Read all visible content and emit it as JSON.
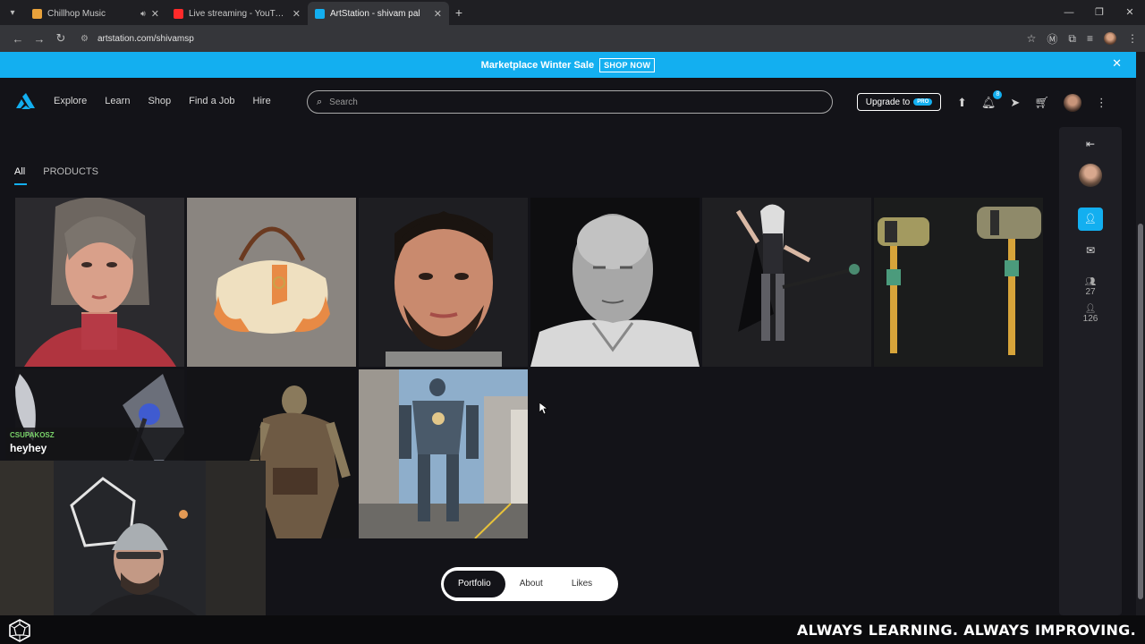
{
  "browser": {
    "tabs": [
      {
        "title": "Chillhop Music",
        "fav_color": "#e9a23b",
        "audio": true
      },
      {
        "title": "Live streaming - YouTube Studio",
        "fav_color": "#ff2a2a",
        "audio": false
      },
      {
        "title": "ArtStation - shivam pal",
        "fav_color": "#13aff0",
        "audio": false
      }
    ],
    "url": "artstation.com/shivamsp"
  },
  "promo": {
    "text": "Marketplace Winter Sale",
    "cta": "SHOP NOW"
  },
  "header": {
    "nav": [
      "Explore",
      "Learn",
      "Shop",
      "Find a Job",
      "Hire"
    ],
    "search_placeholder": "Search",
    "upgrade_label": "Upgrade to",
    "pro_badge": "PRO",
    "notification_count": "8"
  },
  "filter_tabs": [
    "All",
    "PRODUCTS"
  ],
  "gallery": [
    {
      "subject": "red-haired woman 3D bust"
    },
    {
      "subject": "cream handbag render"
    },
    {
      "subject": "bearded man 3D portrait"
    },
    {
      "subject": "old man clay sculpt"
    },
    {
      "subject": "dark fantasy female warrior"
    },
    {
      "subject": "sci-fi hammers"
    },
    {
      "subject": "fantasy axe"
    },
    {
      "subject": "orc warrior"
    },
    {
      "subject": "mech robot in city"
    }
  ],
  "sidebar": {
    "followers": "27",
    "following": "126"
  },
  "bottom_nav": [
    "Portfolio",
    "About",
    "Likes"
  ],
  "overlay": {
    "chat_user": "CSUPAKOSZ",
    "chat_message": "heyhey",
    "slogan": "ALWAYS LEARNING. ALWAYS IMPROVING."
  },
  "colors": {
    "accent": "#13aff0",
    "background": "#131318"
  }
}
